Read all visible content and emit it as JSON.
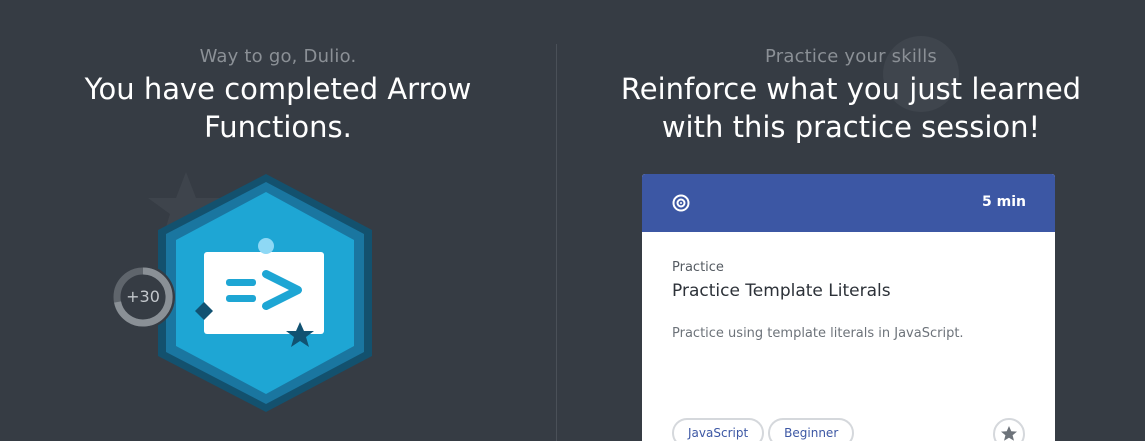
{
  "completion": {
    "greeting": "Way to go, Dulio.",
    "headline_line1": "You have completed Arrow",
    "headline_line2": "Functions.",
    "xp_points": "+30",
    "badge_symbol": "=>"
  },
  "practice": {
    "eyebrow": "Practice your skills",
    "headline_line1": "Reinforce what you just learned",
    "headline_line2": "with this practice session!",
    "card": {
      "duration": "5 min",
      "type": "Practice",
      "title": "Practice Template Literals",
      "description": "Practice using template literals in JavaScript.",
      "tags": [
        "JavaScript",
        "Beginner"
      ]
    }
  },
  "colors": {
    "background": "#363c44",
    "badge_outer": "#13516e",
    "badge_mid": "#1a76a0",
    "badge_inner": "#1ea6d4",
    "card_header": "#3c57a4"
  }
}
